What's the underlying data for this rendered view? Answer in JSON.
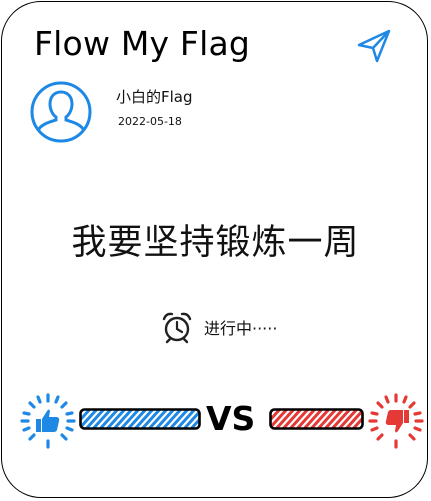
{
  "app": {
    "title": "Flow My Flag"
  },
  "post": {
    "author": "小白的Flag",
    "date": "2022-05-18",
    "goal": "我要坚持锻炼一周",
    "status": "进行中·····"
  },
  "vote": {
    "vs_label": "VS",
    "support_color": "#1e88e5",
    "oppose_color": "#e53935"
  },
  "icons": {
    "send": "send-icon",
    "avatar": "user-avatar-icon",
    "clock": "alarm-clock-icon",
    "thumbs_up": "thumbs-up-icon",
    "thumbs_down": "thumbs-down-icon"
  },
  "colors": {
    "accent": "#1e88e5",
    "danger": "#e53935",
    "text": "#111111"
  }
}
